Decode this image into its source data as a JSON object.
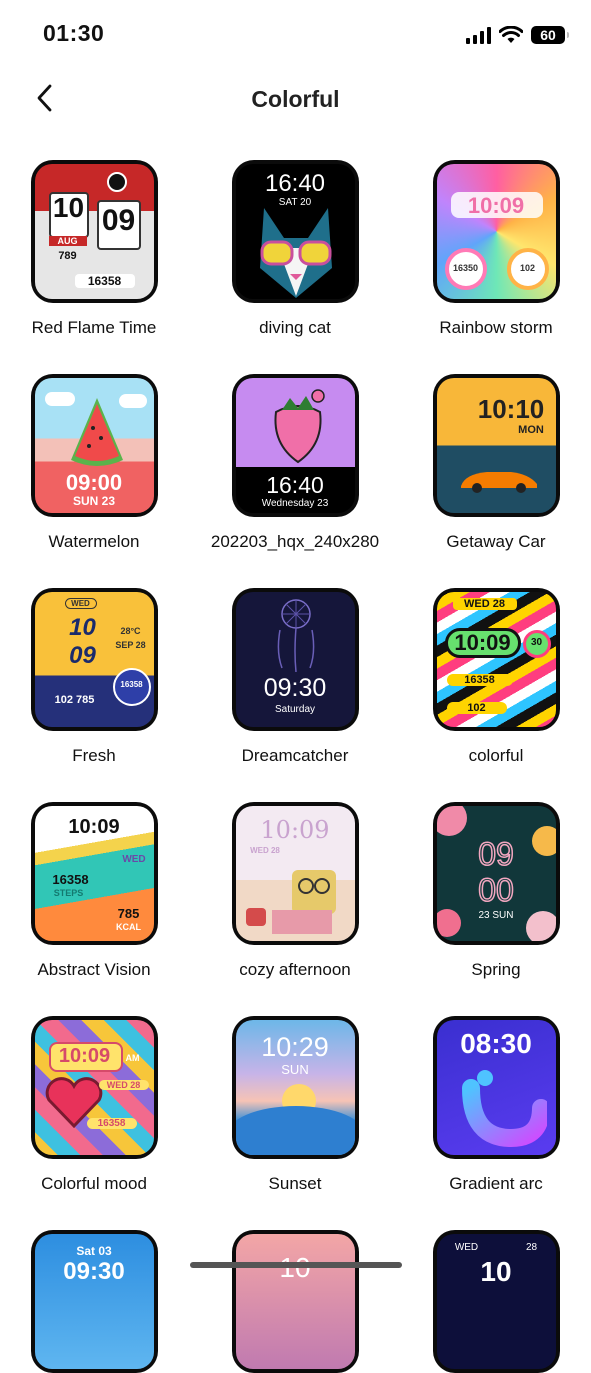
{
  "status_bar": {
    "time": "01:30",
    "battery": "60"
  },
  "header": {
    "title": "Colorful"
  },
  "faces": [
    {
      "name": "Red Flame Time",
      "texts": [
        "10",
        "09",
        "AUG",
        "789",
        "16358"
      ]
    },
    {
      "name": "diving cat",
      "texts": [
        "16:40",
        "SAT 20"
      ]
    },
    {
      "name": "Rainbow storm",
      "texts": [
        "10:09",
        "16350",
        "102"
      ]
    },
    {
      "name": "Watermelon",
      "texts": [
        "09:00",
        "SUN 23"
      ]
    },
    {
      "name": "202203_hqx_240x280",
      "texts": [
        "16:40",
        "Wednesday 23"
      ]
    },
    {
      "name": "Getaway Car",
      "texts": [
        "10:10",
        "MON"
      ]
    },
    {
      "name": "Fresh",
      "texts": [
        "10",
        "09",
        "WED",
        "28°C",
        "SEP 28",
        "102 785",
        "16358"
      ]
    },
    {
      "name": "Dreamcatcher",
      "texts": [
        "09:30",
        "Saturday"
      ]
    },
    {
      "name": "colorful",
      "texts": [
        "WED 28",
        "10:09",
        "30",
        "16358",
        "102"
      ]
    },
    {
      "name": "Abstract Vision",
      "texts": [
        "10:09",
        "WED",
        "16358",
        "STEPS",
        "785",
        "KCAL"
      ]
    },
    {
      "name": "cozy afternoon",
      "texts": [
        "10:09",
        "WED 28"
      ]
    },
    {
      "name": "Spring",
      "texts": [
        "09",
        "00",
        "23 SUN"
      ]
    },
    {
      "name": "Colorful mood",
      "texts": [
        "10:09",
        "AM",
        "WED 28",
        "16358"
      ]
    },
    {
      "name": "Sunset",
      "texts": [
        "10:29",
        "SUN"
      ]
    },
    {
      "name": "Gradient arc",
      "texts": [
        "08:30"
      ]
    },
    {
      "name": "",
      "texts": [
        "Sat 03",
        "09:30"
      ]
    },
    {
      "name": "",
      "texts": [
        "10"
      ]
    },
    {
      "name": "",
      "texts": [
        "WED",
        "28",
        "10"
      ]
    }
  ]
}
